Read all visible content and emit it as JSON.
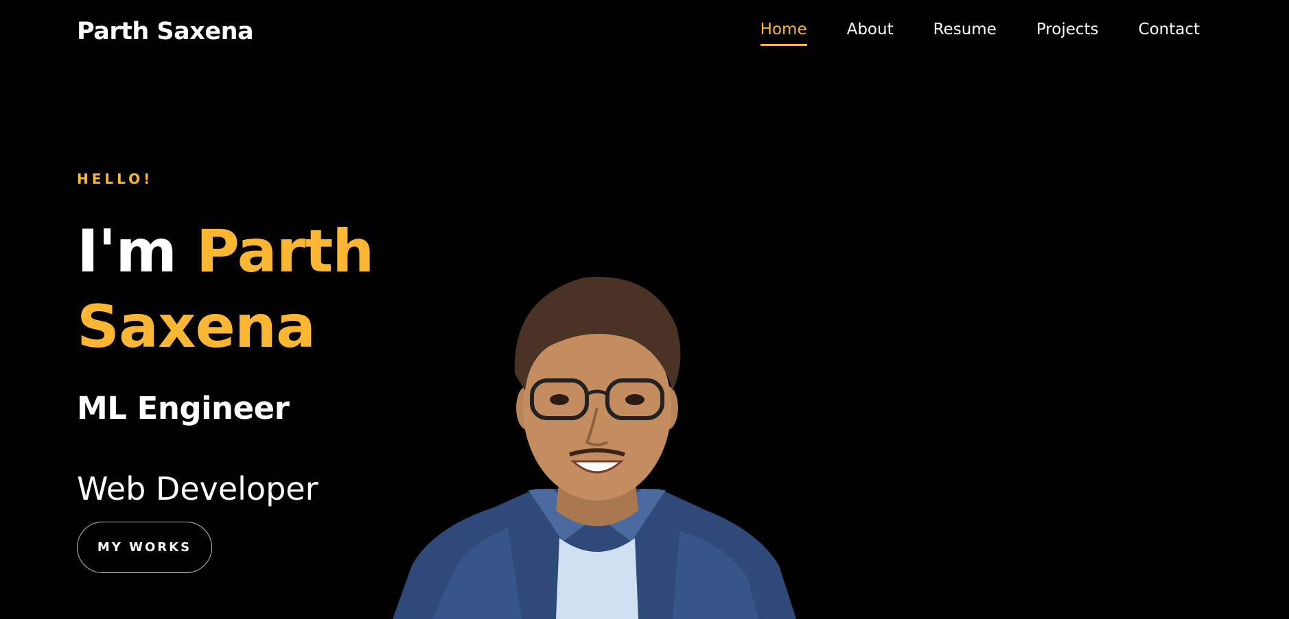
{
  "header": {
    "logo": "Parth Saxena",
    "nav": [
      {
        "label": "Home",
        "active": true
      },
      {
        "label": "About",
        "active": false
      },
      {
        "label": "Resume",
        "active": false
      },
      {
        "label": "Projects",
        "active": false
      },
      {
        "label": "Contact",
        "active": false
      }
    ]
  },
  "hero": {
    "greeting": "HELLO!",
    "title_prefix": "I'm",
    "title_name_line1": "Parth",
    "title_name_line2": "Saxena",
    "role_primary": "ML Engineer",
    "role_secondary": "Web Developer",
    "cta_label": "MY WORKS"
  },
  "colors": {
    "background": "#000000",
    "accent": "#fbb733",
    "text": "#ffffff"
  }
}
